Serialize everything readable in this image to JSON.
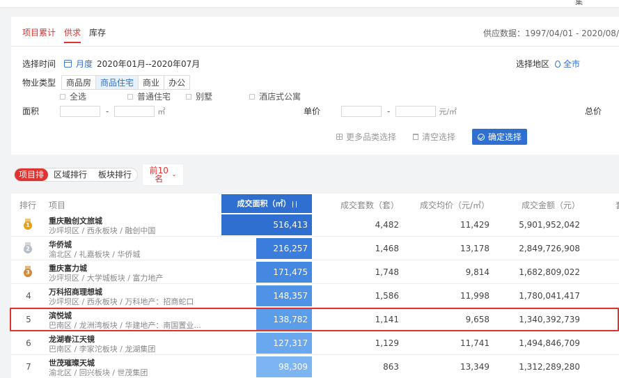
{
  "header": {
    "corner_text": "集"
  },
  "tabs": [
    {
      "label": "项目累计",
      "active": true
    },
    {
      "label": "供求",
      "active": true
    },
    {
      "label": "库存",
      "active": false
    }
  ],
  "supply_data": "供应数据：1997/04/01 - 2020/08/",
  "filters": {
    "time_label": "选择时间",
    "period": "月度",
    "range": "2020年01月--2020年07月",
    "region_label": "选择地区",
    "region_value": "全市",
    "property_label": "物业类型",
    "property_types": [
      {
        "label": "商品房",
        "active": false
      },
      {
        "label": "商品住宅",
        "active": true
      },
      {
        "label": "商业",
        "active": false
      },
      {
        "label": "办公",
        "active": false
      }
    ],
    "sub_types": [
      "全选",
      "普通住宅",
      "别墅",
      "酒店式公寓"
    ],
    "area_label": "面积",
    "area_unit": "㎡",
    "price_label": "单价",
    "price_unit": "元/㎡",
    "total_label": "总价",
    "dash": "-"
  },
  "actions": {
    "more": "更多品类选择",
    "clear": "清空选择",
    "confirm": "确定选择"
  },
  "ranking": {
    "modes": [
      {
        "label": "项目排",
        "active": true
      },
      {
        "label": "区域排行",
        "active": false
      },
      {
        "label": "板块排行",
        "active": false
      }
    ],
    "topn": "前10名"
  },
  "table": {
    "headers": {
      "rank": "排行",
      "project": "项目",
      "area": "成交面积（㎡）",
      "sets": "成交套数（套）",
      "avg": "成交均价（元/㎡）",
      "amount": "成交金额（元）",
      "extra": "套"
    },
    "bar_max": 516413,
    "rows": [
      {
        "rank": "1",
        "medal": "gold",
        "name": "重庆融创文旅城",
        "desc": "沙坪坝区 / 西永板块 / 融创中国",
        "area": 516413,
        "area_text": "516,413",
        "sets": "4,482",
        "avg": "11,429",
        "amount": "5,901,952,042",
        "highlight": false
      },
      {
        "rank": "2",
        "medal": "silver",
        "name": "华侨城",
        "desc": "渝北区 / 礼嘉板块 / 华侨城",
        "area": 216257,
        "area_text": "216,257",
        "sets": "1,468",
        "avg": "13,178",
        "amount": "2,849,726,908",
        "highlight": false
      },
      {
        "rank": "3",
        "medal": "bronze",
        "name": "重庆富力城",
        "desc": "沙坪坝区 / 大学城板块 / 富力地产",
        "area": 171475,
        "area_text": "171,475",
        "sets": "1,748",
        "avg": "9,814",
        "amount": "1,682,809,022",
        "highlight": false
      },
      {
        "rank": "4",
        "medal": "",
        "name": "万科招商理想城",
        "desc": "沙坪坝区 / 西永板块 / 万科地产：招商蛇口",
        "area": 148357,
        "area_text": "148,357",
        "sets": "1,586",
        "avg": "11,998",
        "amount": "1,780,041,417",
        "highlight": false
      },
      {
        "rank": "5",
        "medal": "",
        "name": "滨悦城",
        "desc": "巴南区 / 龙洲湾板块 / 华建地产：南国置业...",
        "area": 138782,
        "area_text": "138,782",
        "sets": "1,141",
        "avg": "9,658",
        "amount": "1,340,392,739",
        "highlight": true
      },
      {
        "rank": "6",
        "medal": "",
        "name": "龙湖春江天镜",
        "desc": "巴南区 / 李家沱板块 / 龙湖集团",
        "area": 127317,
        "area_text": "127,317",
        "sets": "1,129",
        "avg": "11,741",
        "amount": "1,494,846,709",
        "highlight": false
      },
      {
        "rank": "7",
        "medal": "",
        "name": "世茂璀璨天城",
        "desc": "渝北区 / 回兴板块 / 世茂集团",
        "area": 98309,
        "area_text": "98,309",
        "sets": "863",
        "avg": "13,349",
        "amount": "1,312,289,280",
        "highlight": false
      }
    ]
  },
  "colors": {
    "accent_red": "#e0322f",
    "accent_blue": "#2f6fd0",
    "bar_colors": [
      "#2f6fd0",
      "#3a7ddc",
      "#4588e2",
      "#5093e6",
      "#5c9dea",
      "#69a8ee",
      "#7db4f2"
    ],
    "gold": "#e3a11e",
    "silver": "#b8bec6",
    "bronze": "#d08b3a"
  }
}
